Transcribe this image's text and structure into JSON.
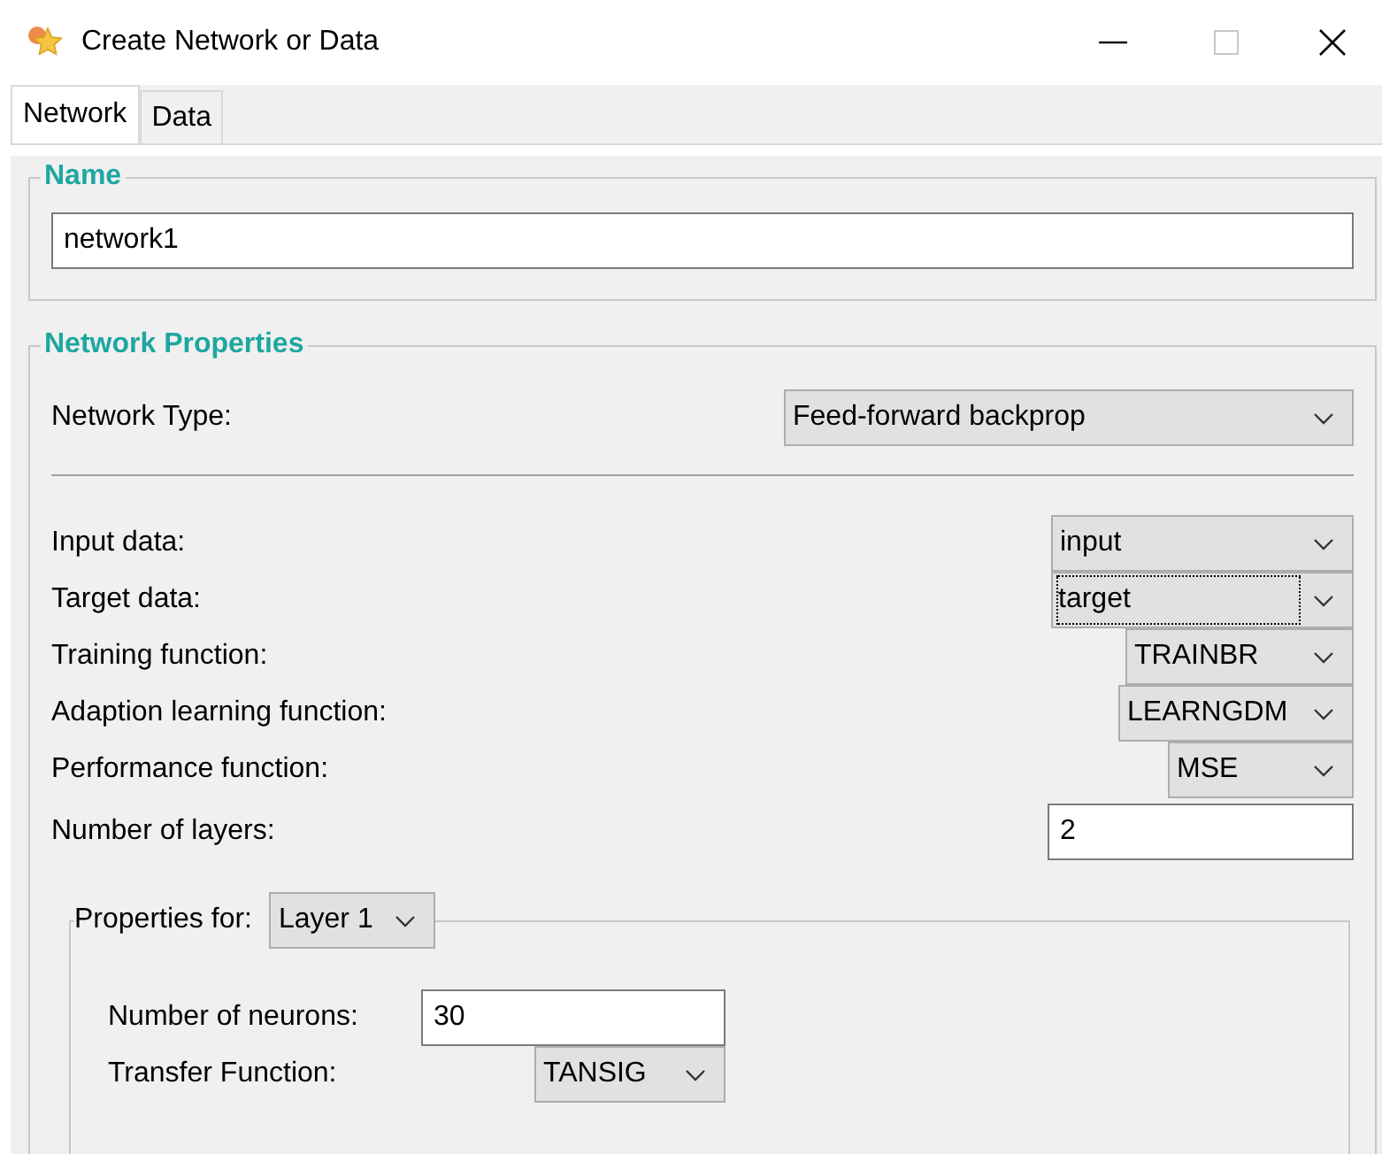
{
  "window": {
    "title": "Create Network or Data",
    "maximize_disabled": true
  },
  "tabs": [
    {
      "label": "Network",
      "selected": true
    },
    {
      "label": "Data",
      "selected": false
    }
  ],
  "name_group": {
    "title": "Name",
    "value": "network1"
  },
  "properties": {
    "title": "Network Properties",
    "network_type": {
      "label": "Network Type:",
      "value": "Feed-forward backprop"
    },
    "rows": [
      {
        "kind": "dropdown",
        "label": "Input data:",
        "value": "input",
        "focused": false
      },
      {
        "kind": "dropdown",
        "label": "Target data:",
        "value": "target",
        "focused": true
      },
      {
        "kind": "dropdown",
        "label": "Training function:",
        "value": "TRAINBR",
        "focused": false
      },
      {
        "kind": "dropdown",
        "label": "Adaption learning function:",
        "value": "LEARNGDM",
        "focused": false
      },
      {
        "kind": "dropdown",
        "label": "Performance function:",
        "value": "MSE",
        "focused": false
      },
      {
        "kind": "text",
        "label": "Number of layers:",
        "value": "2"
      }
    ],
    "layer_group": {
      "label": "Properties for:",
      "layer": "Layer 1",
      "rows": [
        {
          "kind": "text",
          "label": "Number of neurons:",
          "value": "30"
        },
        {
          "kind": "dropdown",
          "label": "Transfer Function:",
          "value": "TANSIG",
          "focused": false
        }
      ]
    }
  }
}
